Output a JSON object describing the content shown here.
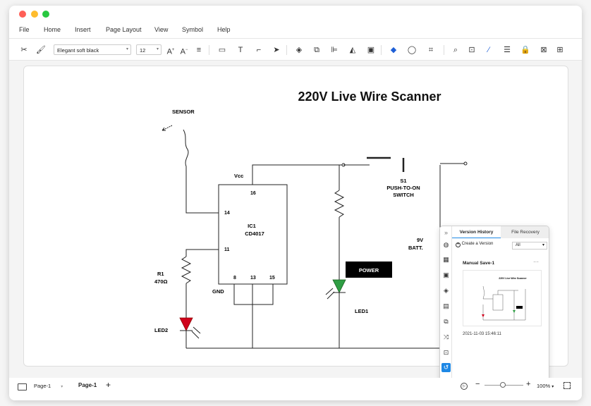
{
  "window": {
    "dots": [
      {
        "name": "close",
        "color": "#ff5f57"
      },
      {
        "name": "minimize",
        "color": "#febc2e"
      },
      {
        "name": "zoom",
        "color": "#28c840"
      }
    ]
  },
  "menu": [
    "File",
    "Home",
    "Insert",
    "Page Layout",
    "View",
    "Symbol",
    "Help"
  ],
  "toolbar": {
    "font": "Elegant soft black",
    "size": "12"
  },
  "diagram": {
    "title": "220V Live Wire Scanner",
    "labels": {
      "sensor": "SENSOR",
      "vcc": "Vcc",
      "pin16": "16",
      "pin14": "14",
      "pin11": "11",
      "pin8": "8",
      "pin13": "13",
      "pin15": "15",
      "ic_name": "IC1",
      "ic_part": "CD4017",
      "gnd": "GND",
      "r1": "R1",
      "r1_value": "470Ω",
      "led2": "LED2",
      "led1": "LED1",
      "power": "POWER",
      "s1": "S1",
      "s1_desc1": "PUSH-TO-ON",
      "s1_desc2": "SWITCH",
      "batt1": "9V",
      "batt2": "BATT."
    },
    "colors": {
      "led2": "#d0021b",
      "led1": "#2f9e44",
      "power_bg": "#000000"
    }
  },
  "version_panel": {
    "tab_active": "Version History",
    "tab_other": "File Recovery",
    "create_label": "Create a Version",
    "filter": "All",
    "entry_title": "Manual Save-1",
    "entry_date": "2021-11-03 15:46:11",
    "thumb_title": "220V Live Wire Scanner",
    "accent": "#1e88e5"
  },
  "status": {
    "page_select": "Page-1",
    "page_tab": "Page-1",
    "add": "+",
    "zoom": "100%"
  }
}
